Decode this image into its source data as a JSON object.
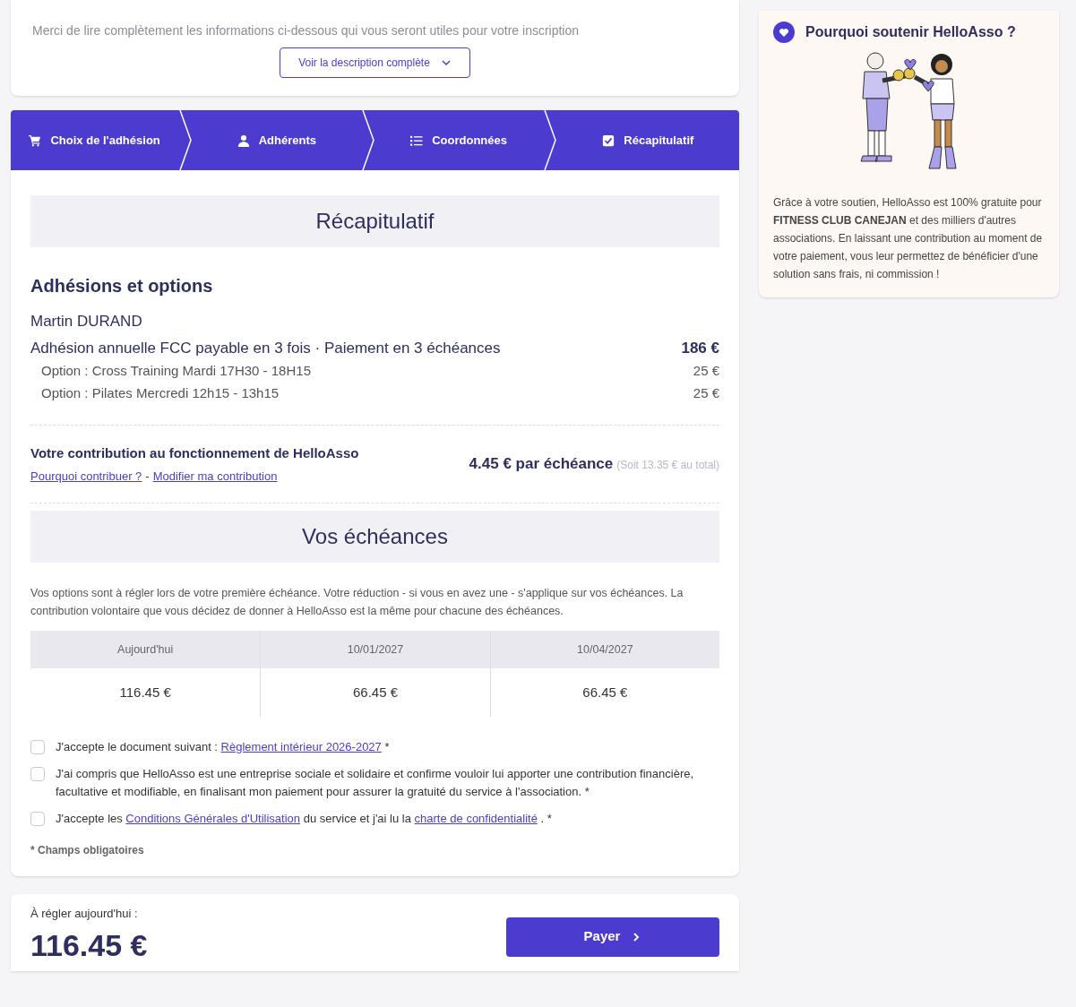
{
  "description": {
    "text": "Merci de lire complètement les informations ci-dessous qui vous seront utiles pour votre inscription",
    "button": "Voir la description complète"
  },
  "steps": [
    {
      "label": "Choix de l'adhésion"
    },
    {
      "label": "Adhérents"
    },
    {
      "label": "Coordonnées"
    },
    {
      "label": "Récapitulatif"
    }
  ],
  "recap": {
    "title": "Récapitulatif",
    "section_title": "Adhésions et options",
    "member": "Martin DURAND",
    "items": [
      {
        "kind": "main",
        "label": "Adhésion annuelle FCC payable en 3 fois · Paiement en 3 échéances",
        "price": "186 €"
      },
      {
        "kind": "option",
        "label": "Option : Cross Training Mardi 17H30 - 18H15",
        "price": "25 €"
      },
      {
        "kind": "option",
        "label": "Option : Pilates Mercredi 12h15 - 13h15",
        "price": "25 €"
      }
    ],
    "contribution": {
      "title": "Votre contribution au fonctionnement de HelloAsso",
      "links": [
        "Pourquoi contribuer ?",
        "Modifier ma contribution"
      ],
      "separator": "-",
      "amount": "4.45 € par échéance",
      "total": "(Soit 13.35 € au total)"
    }
  },
  "schedule": {
    "title": "Vos échéances",
    "note": "Vos options sont à régler lors de votre première échéance. Votre réduction - si vous en avez une - s'applique sur vos échéances. La contribution volontaire que vous décidez de donner à HelloAsso est la même pour chacune des échéances.",
    "columns": [
      {
        "date": "Aujourd'hui",
        "amount": "116.45 €"
      },
      {
        "date": "10/01/2027",
        "amount": "66.45 €"
      },
      {
        "date": "10/04/2027",
        "amount": "66.45 €"
      }
    ]
  },
  "consents": [
    {
      "checked": false,
      "parts": [
        {
          "kind": "text",
          "text": "J'accepte le document suivant : "
        },
        {
          "kind": "link",
          "text": "Règlement intérieur 2026-2027"
        },
        {
          "kind": "text",
          "text": " *"
        }
      ]
    },
    {
      "checked": false,
      "parts": [
        {
          "kind": "text",
          "text": "J'ai compris que HelloAsso est une entreprise sociale et solidaire et confirme vouloir lui apporter une contribution financière, facultative et modifiable, en finalisant mon paiement pour assurer la gratuité du service à l'association. *"
        }
      ]
    },
    {
      "checked": false,
      "parts": [
        {
          "kind": "text",
          "text": "J'accepte les "
        },
        {
          "kind": "link",
          "text": "Conditions Générales d'Utilisation"
        },
        {
          "kind": "text",
          "text": " du service et j'ai lu la "
        },
        {
          "kind": "link",
          "text": "charte de confidentialité"
        },
        {
          "kind": "text",
          "text": " . *"
        }
      ]
    }
  ],
  "required_note": "* Champs obligatoires",
  "payment": {
    "label": "À régler aujourd'hui :",
    "amount": "116.45 €",
    "button": "Payer"
  },
  "sidebar": {
    "title": "Pourquoi soutenir HelloAsso ?",
    "text": "Grâce à votre soutien, HelloAsso est 100% gratuite pour **FITNESS CLUB CANEJAN** et des milliers d'autres associations. En laissant une contribution au moment de votre paiement, vous leur permettez de bénéficier d'une solution sans frais, ni commission !"
  }
}
